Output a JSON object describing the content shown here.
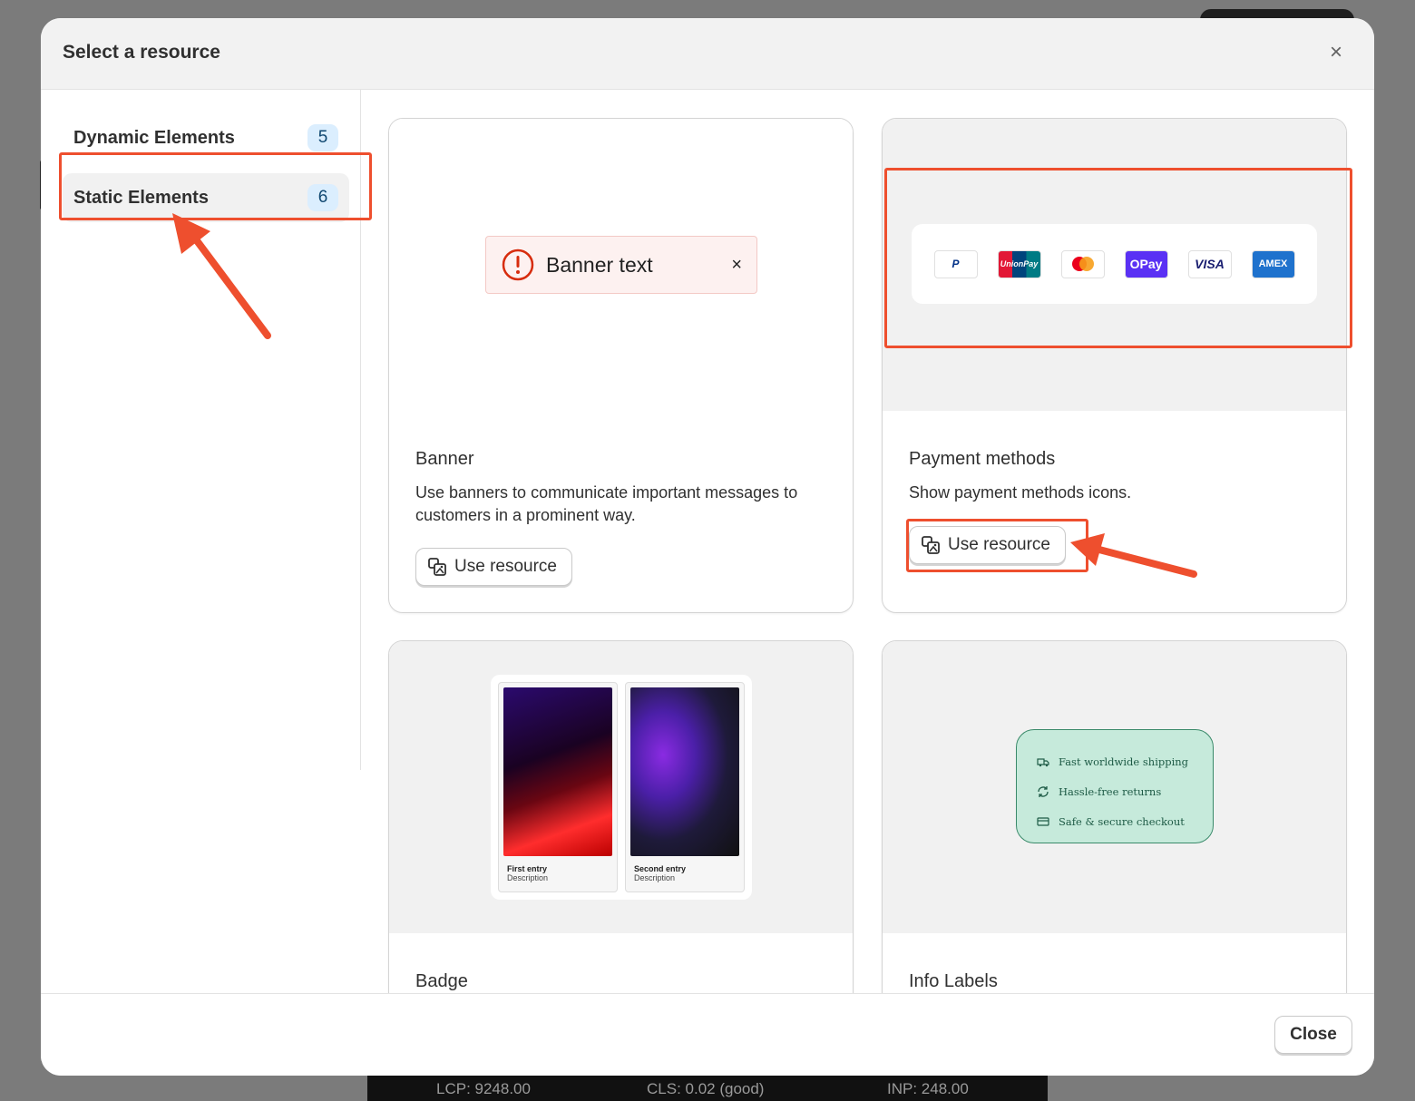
{
  "modal": {
    "title": "Select a resource",
    "close_label": "×"
  },
  "sidebar": {
    "items": [
      {
        "label": "Dynamic Elements",
        "count": "5"
      },
      {
        "label": "Static Elements",
        "count": "6"
      }
    ]
  },
  "cards": [
    {
      "title": "Banner",
      "description": "Use banners to communicate important messages to customers in a prominent way.",
      "button": "Use resource",
      "preview": {
        "banner_text": "Banner text",
        "close": "×"
      }
    },
    {
      "title": "Payment methods",
      "description": "Show payment methods icons.",
      "button": "Use resource",
      "preview": {
        "logos": [
          "PayPal",
          "UnionPay 银联",
          "Mastercard",
          "OPay",
          "VISA",
          "AMEX"
        ]
      }
    },
    {
      "title": "Badge",
      "preview": {
        "entries": [
          {
            "title": "First entry",
            "description": "Description"
          },
          {
            "title": "Second entry",
            "description": "Description"
          }
        ]
      }
    },
    {
      "title": "Info Labels",
      "preview": {
        "rows": [
          "Fast worldwide shipping",
          "Hassle-free returns",
          "Safe & secure checkout"
        ]
      }
    }
  ],
  "footer": {
    "close_label": "Close"
  },
  "perf": {
    "lcp": "LCP: 9248.00",
    "cls": "CLS: 0.02 (good)",
    "inp": "INP: 248.00"
  },
  "colors": {
    "annotation": "#ee4f2e",
    "badge_bg": "#dbeefe",
    "info_bg": "#c6eadb"
  }
}
